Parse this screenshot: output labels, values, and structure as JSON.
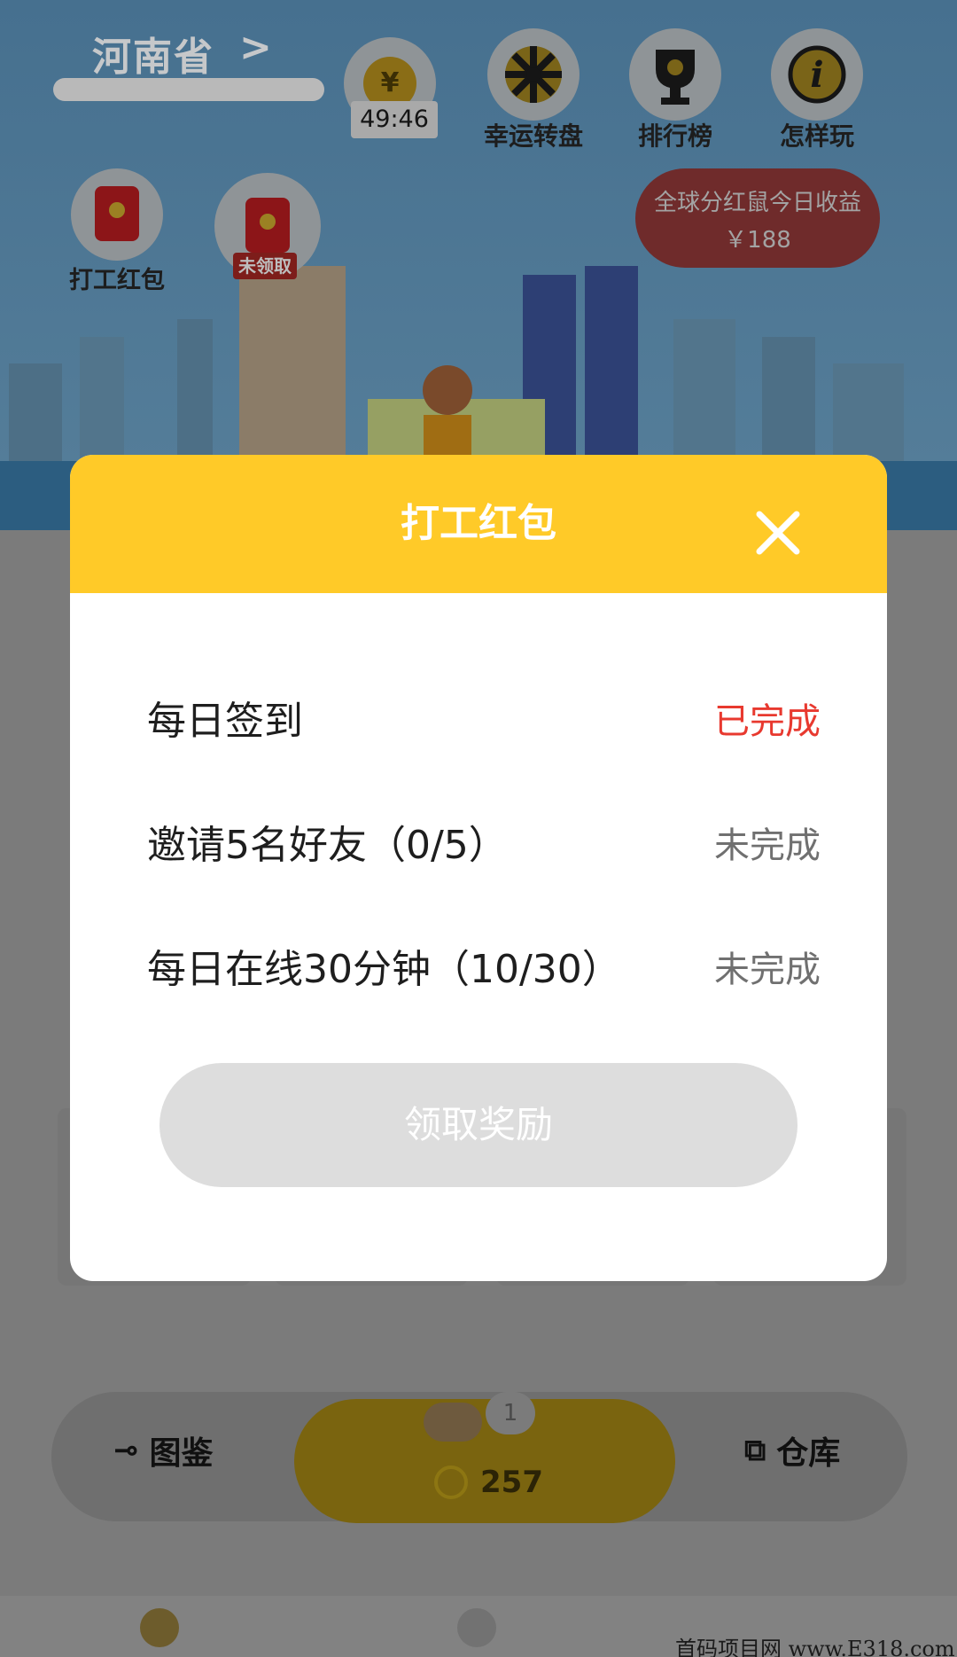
{
  "header": {
    "province": "河南省",
    "timer": "49:46"
  },
  "top_icons": [
    {
      "label": "幸运转盘",
      "icon": "wheel-icon"
    },
    {
      "label": "排行榜",
      "icon": "trophy-icon"
    },
    {
      "label": "怎样玩",
      "icon": "info-icon"
    }
  ],
  "red_packets": [
    {
      "label": "打工红包",
      "icon": "red-envelope-icon"
    },
    {
      "tag": "未领取",
      "icon": "red-envelope-icon"
    }
  ],
  "global_earnings": {
    "line1": "全球分红鼠今日收益",
    "line2": "￥188"
  },
  "bottom": {
    "catalog_label": "图鉴",
    "warehouse_label": "仓库",
    "coins": "257",
    "mouse_count": "1"
  },
  "watermark": "首码项目网 www.E318.com",
  "modal": {
    "title": "打工红包",
    "tasks": [
      {
        "label": "每日签到",
        "status": "已完成",
        "done": true
      },
      {
        "label": "邀请5名好友（0/5）",
        "status": "未完成",
        "done": false
      },
      {
        "label": "每日在线30分钟（10/30）",
        "status": "未完成",
        "done": false
      }
    ],
    "claim_button": "领取奖励"
  },
  "colors": {
    "modal_header": "#ffca28",
    "status_done": "#e8392f",
    "status_pending": "#707070",
    "claim_disabled": "#dddddd"
  }
}
